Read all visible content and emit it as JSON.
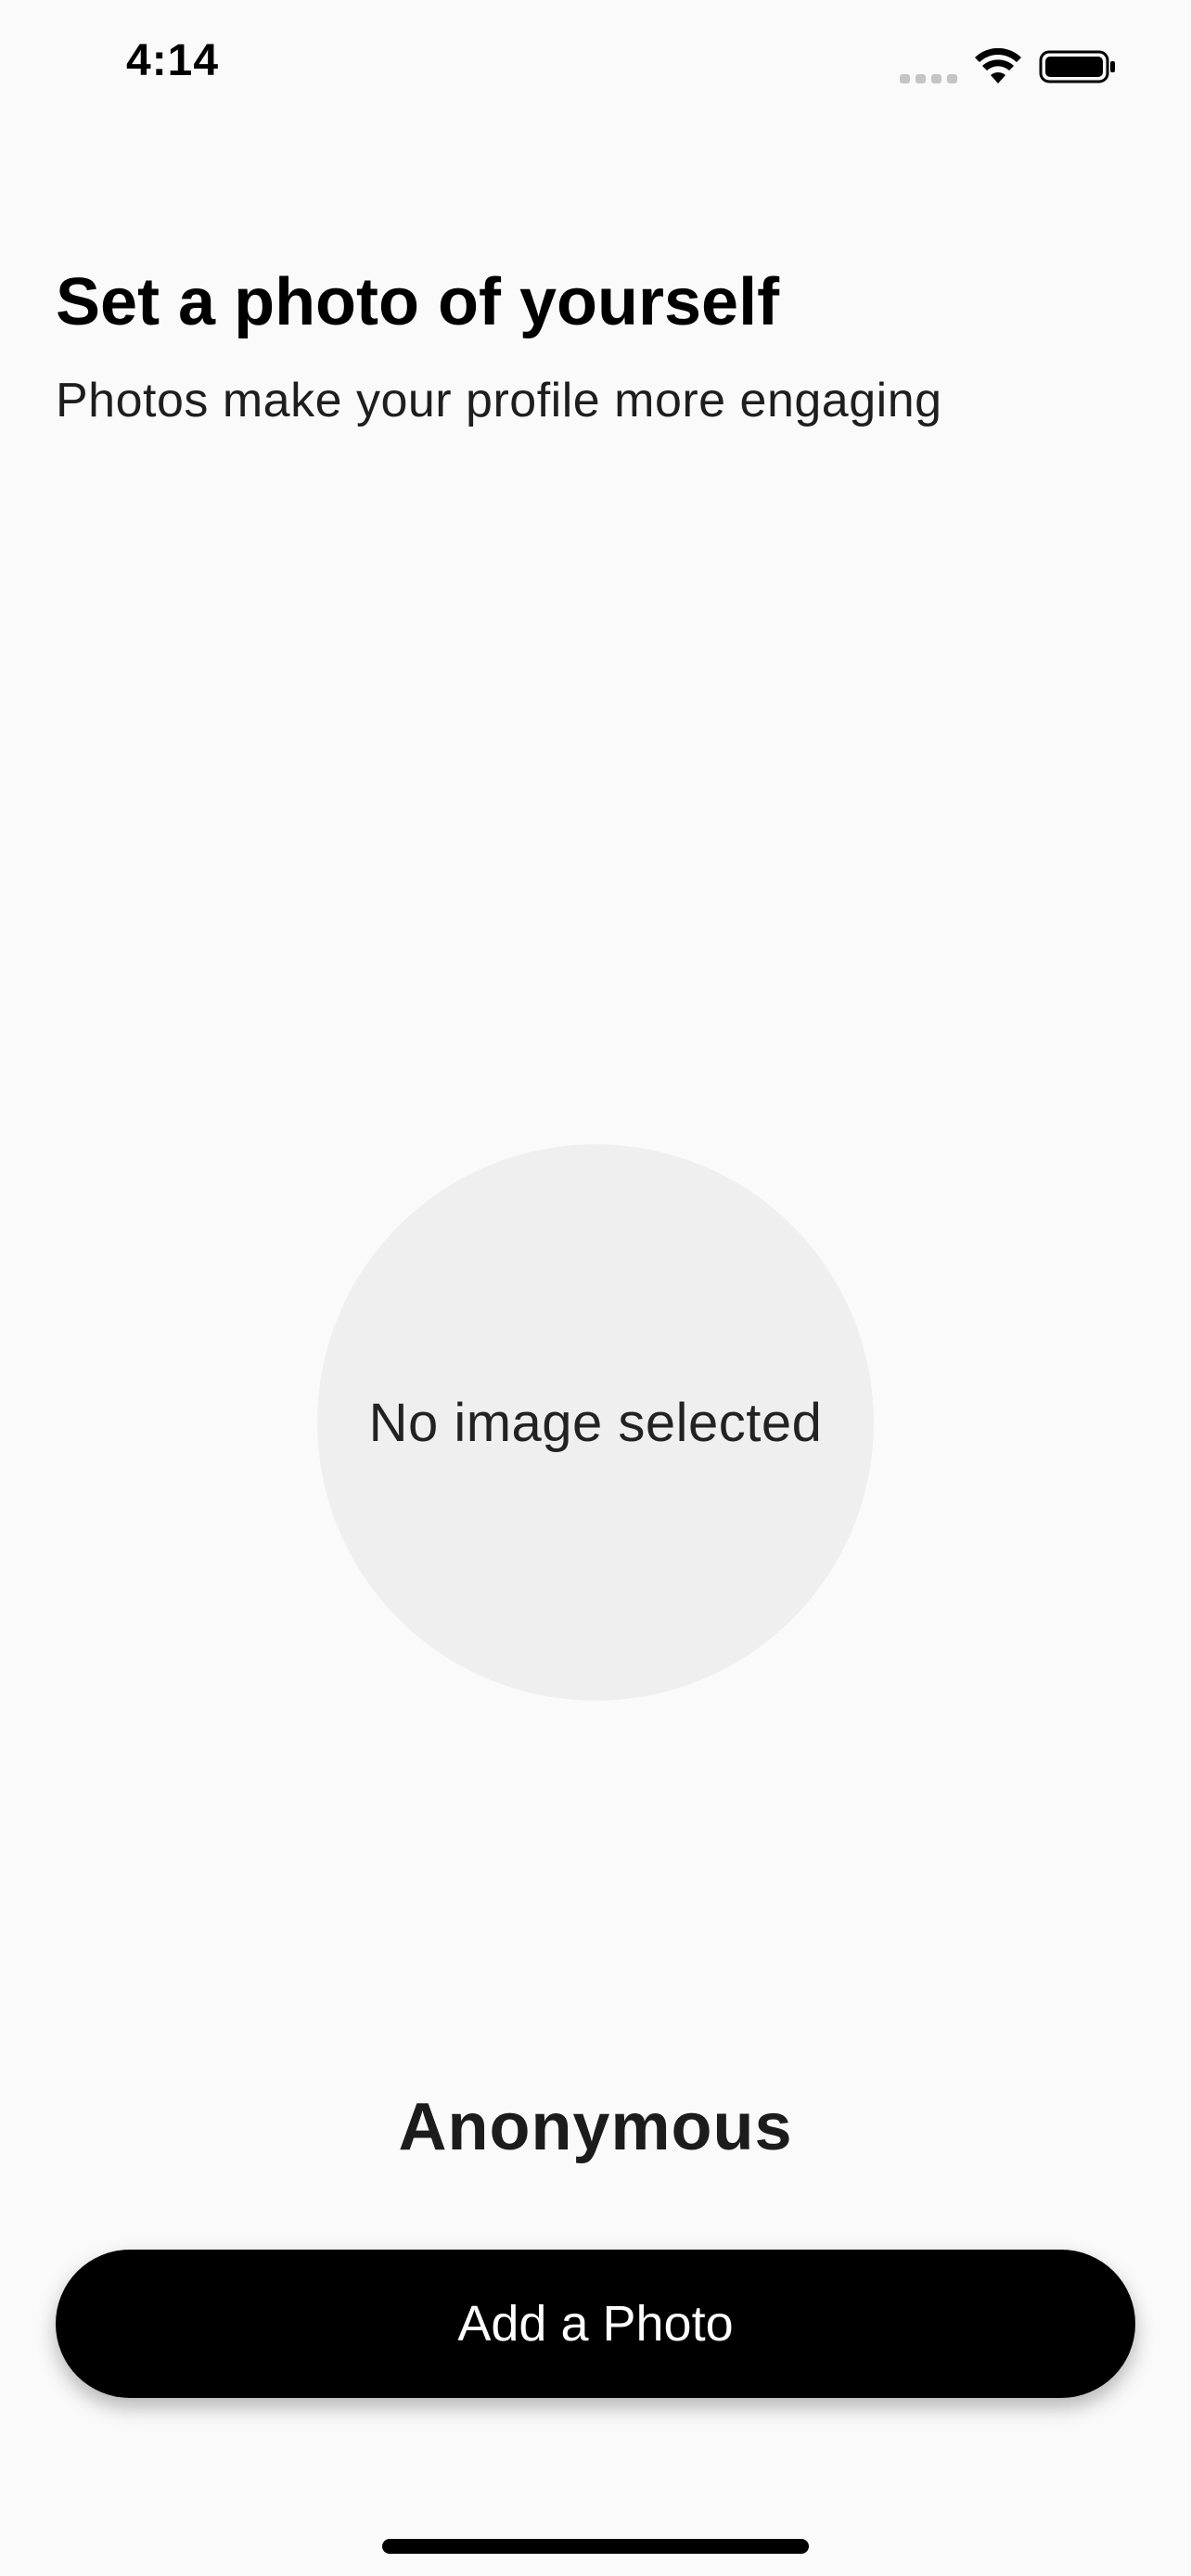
{
  "status_bar": {
    "time": "4:14",
    "icons": [
      "signal-icon",
      "wifi-icon",
      "battery-icon"
    ]
  },
  "header": {
    "title": "Set a photo of yourself",
    "subtitle": "Photos make your profile more engaging"
  },
  "avatar": {
    "placeholder_text": "No image selected"
  },
  "profile": {
    "name": "Anonymous"
  },
  "actions": {
    "add_photo_label": "Add a Photo"
  },
  "colors": {
    "background": "#fafafa",
    "button_background": "#000000",
    "button_text": "#ffffff",
    "avatar_background": "#efefef"
  }
}
